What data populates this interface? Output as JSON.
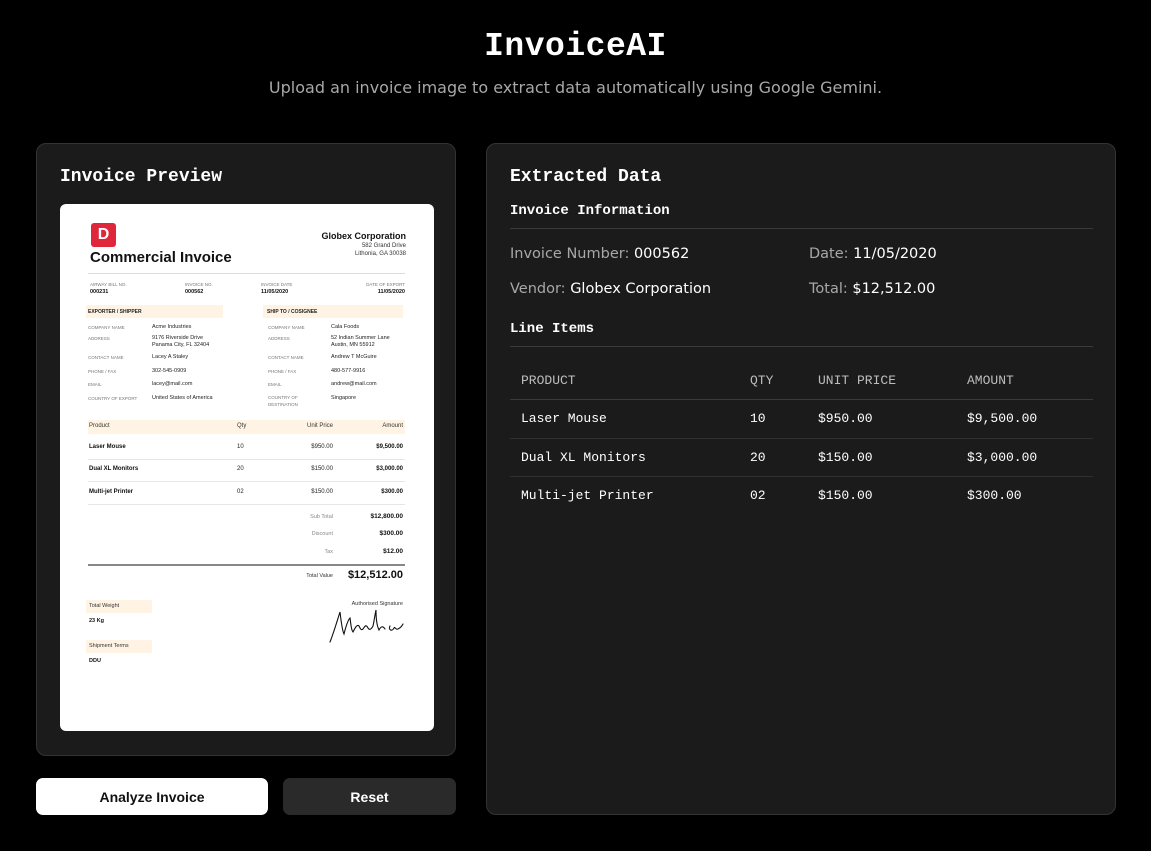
{
  "app": {
    "title": "InvoiceAI",
    "subtitle": "Upload an invoice image to extract data automatically using Google Gemini."
  },
  "preview": {
    "title": "Invoice Preview",
    "invoice": {
      "logo_letter": "D",
      "doc_title": "Commercial Invoice",
      "company": "Globex Corporation",
      "company_addr1": "582 Grand Drive",
      "company_addr2": "Lithonia, GA 30038",
      "meta": [
        {
          "label": "AIRWAY BILL NO.",
          "value": "000231"
        },
        {
          "label": "INVOICE NO.",
          "value": "000562"
        },
        {
          "label": "INVOICE DATE",
          "value": "11/05/2020"
        },
        {
          "label": "DATE OF EXPORT",
          "value": "11/05/2020"
        }
      ],
      "shipper_title": "EXPORTER / SHIPPER",
      "consignee_title": "SHIP TO / COSIGNEE",
      "shipper": [
        {
          "label": "COMPANY NAME",
          "value": "Acme Industries"
        },
        {
          "label": "ADDRESS",
          "value": "9176 Riverside Drive",
          "value2": "Panama City, FL 32404"
        },
        {
          "label": "CONTACT NAME",
          "value": "Lacey A Staley"
        },
        {
          "label": "PHONE / FAX",
          "value": "302-545-0909"
        },
        {
          "label": "EMAIL",
          "value": "lacey@mail.com"
        },
        {
          "label": "COUNTRY OF EXPORT",
          "value": "United States of America"
        }
      ],
      "consignee": [
        {
          "label": "COMPANY NAME",
          "value": "Cala Foods"
        },
        {
          "label": "ADDRESS",
          "value": "52 Indian Summer Lane",
          "value2": "Austin, MN 55912"
        },
        {
          "label": "CONTACT NAME",
          "value": "Andrew T McGuire"
        },
        {
          "label": "PHONE / FAX",
          "value": "480-577-9916"
        },
        {
          "label": "EMAIL",
          "value": "andrew@mail.com"
        },
        {
          "label": "COUNTRY OF",
          "label2": "DESTINATION",
          "value": "Singapore"
        }
      ],
      "table_headers": {
        "product": "Product",
        "qty": "Qty",
        "unit_price": "Unit Price",
        "amount": "Amount"
      },
      "rows": [
        {
          "product": "Laser Mouse",
          "qty": "10",
          "unit_price": "$950.00",
          "amount": "$9,500.00"
        },
        {
          "product": "Dual XL Monitors",
          "qty": "20",
          "unit_price": "$150.00",
          "amount": "$3,000.00"
        },
        {
          "product": "Multi-jet Printer",
          "qty": "02",
          "unit_price": "$150.00",
          "amount": "$300.00"
        }
      ],
      "subtotal_label": "Sub Total",
      "subtotal": "$12,800.00",
      "discount_label": "Discount",
      "discount": "$300.00",
      "tax_label": "Tax",
      "tax": "$12.00",
      "total_label": "Total Value",
      "total": "$12,512.00",
      "weight_label": "Total Weight",
      "weight": "23 Kg",
      "terms_label": "Shipment Terms",
      "terms": "DDU",
      "signature_label": "Authorised Signature"
    }
  },
  "buttons": {
    "analyze": "Analyze Invoice",
    "reset": "Reset"
  },
  "extracted": {
    "title": "Extracted Data",
    "info_title": "Invoice Information",
    "invoice_number_label": "Invoice Number:",
    "invoice_number": "000562",
    "date_label": "Date:",
    "date": "11/05/2020",
    "vendor_label": "Vendor:",
    "vendor": "Globex Corporation",
    "total_label": "Total:",
    "total": "$12,512.00",
    "line_items_title": "Line Items",
    "headers": {
      "product": "PRODUCT",
      "qty": "QTY",
      "unit_price": "UNIT PRICE",
      "amount": "AMOUNT"
    },
    "items": [
      {
        "product": "Laser Mouse",
        "qty": "10",
        "unit_price": "$950.00",
        "amount": "$9,500.00"
      },
      {
        "product": "Dual XL Monitors",
        "qty": "20",
        "unit_price": "$150.00",
        "amount": "$3,000.00"
      },
      {
        "product": "Multi-jet Printer",
        "qty": "02",
        "unit_price": "$150.00",
        "amount": "$300.00"
      }
    ]
  }
}
